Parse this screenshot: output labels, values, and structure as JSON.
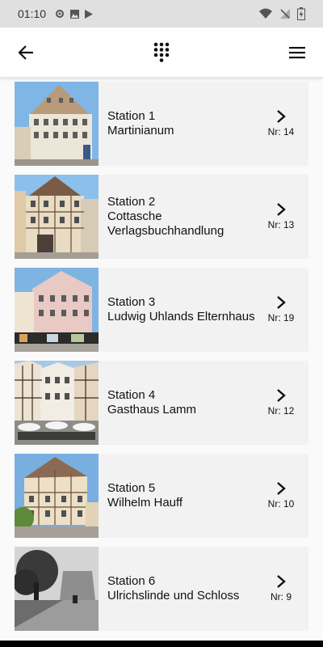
{
  "status_bar": {
    "time": "01:10"
  },
  "stations": [
    {
      "title": "Station 1",
      "name": "Martinianum",
      "nr": "Nr: 14"
    },
    {
      "title": "Station 2",
      "name": "Cottasche Verlagsbuchhandlung",
      "nr": "Nr: 13"
    },
    {
      "title": "Station 3",
      "name": "Ludwig Uhlands Elternhaus",
      "nr": "Nr: 19"
    },
    {
      "title": "Station 4",
      "name": "Gasthaus Lamm",
      "nr": "Nr: 12"
    },
    {
      "title": "Station 5",
      "name": "Wilhelm Hauff",
      "nr": "Nr: 10"
    },
    {
      "title": "Station 6",
      "name": "Ulrichslinde und Schloss",
      "nr": "Nr: 9"
    }
  ],
  "icons": {
    "back": "arrow-left-icon",
    "keypad": "dialpad-icon",
    "menu": "hamburger-menu-icon"
  }
}
